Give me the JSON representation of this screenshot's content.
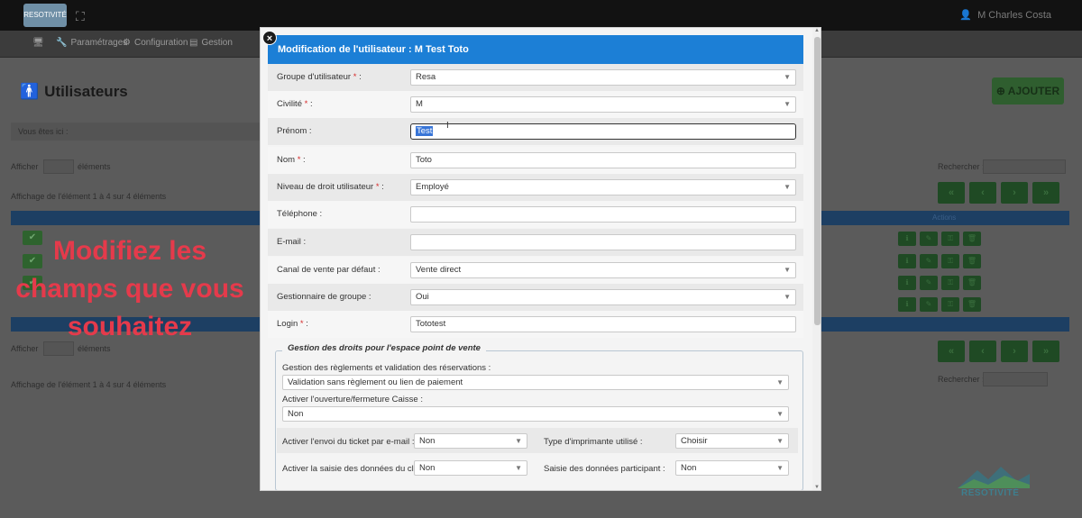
{
  "app": {
    "logo_text": "RESOTIVITÉ",
    "user_name": "M Charles Costa",
    "nav": [
      {
        "label": "Paramétrages"
      },
      {
        "label": "Configuration"
      },
      {
        "label": "Gestion"
      }
    ],
    "page_title": "Utilisateurs",
    "add_button": "AJOUTER",
    "breadcrumb": "Vous êtes ici :",
    "afficher": "Afficher",
    "entries_label": "éléments",
    "info_text": "Affichage de l'élément 1 à 4 sur 4 éléments",
    "search_label": "Rechercher :",
    "col_header": "Actions",
    "overlay_caption": "Modifiez les champs que vous souhaitez",
    "watermark_text": "RESOTIVITÉ"
  },
  "modal": {
    "title": "Modification de l'utilisateur : M Test Toto",
    "fields": [
      {
        "label": "Groupe d'utilisateur",
        "required": true,
        "value": "Resa",
        "kind": "select"
      },
      {
        "label": "Civilité",
        "required": true,
        "value": "M",
        "kind": "select"
      },
      {
        "label": "Prénom",
        "required": false,
        "value": "Test",
        "kind": "text-focused"
      },
      {
        "label": "Nom",
        "required": true,
        "value": "Toto",
        "kind": "text"
      },
      {
        "label": "Niveau de droit utilisateur",
        "required": true,
        "value": "Employé",
        "kind": "select"
      },
      {
        "label": "Téléphone",
        "required": false,
        "value": "",
        "kind": "text"
      },
      {
        "label": "E-mail",
        "required": false,
        "value": "",
        "kind": "text"
      },
      {
        "label": "Canal de vente par défaut",
        "required": false,
        "value": "Vente direct",
        "kind": "select"
      },
      {
        "label": "Gestionnaire de groupe",
        "required": false,
        "value": "Oui",
        "kind": "select"
      },
      {
        "label": "Login",
        "required": true,
        "value": "Tototest",
        "kind": "text"
      }
    ],
    "fieldset": {
      "legend": "Gestion des droits pour l'espace point de vente",
      "reglements_label": "Gestion des règlements et validation des réservations :",
      "reglements_value": "Validation sans règlement ou lien de paiement",
      "caisse_label": "Activer l'ouverture/fermeture Caisse :",
      "caisse_value": "Non",
      "ticket_label": "Activer l'envoi du ticket par e-mail :",
      "ticket_value": "Non",
      "imprimante_label": "Type d'imprimante utilisé :",
      "imprimante_value": "Choisir",
      "saisie_client_label": "Activer la saisie des données du client :",
      "saisie_client_value": "Non",
      "saisie_participant_label": "Saisie des données participant :",
      "saisie_participant_value": "Non"
    }
  },
  "colors": {
    "modal_header": "#1c7fd6",
    "required": "#d62b2b",
    "caption": "#e53a4b",
    "selection": "#3875d7"
  }
}
